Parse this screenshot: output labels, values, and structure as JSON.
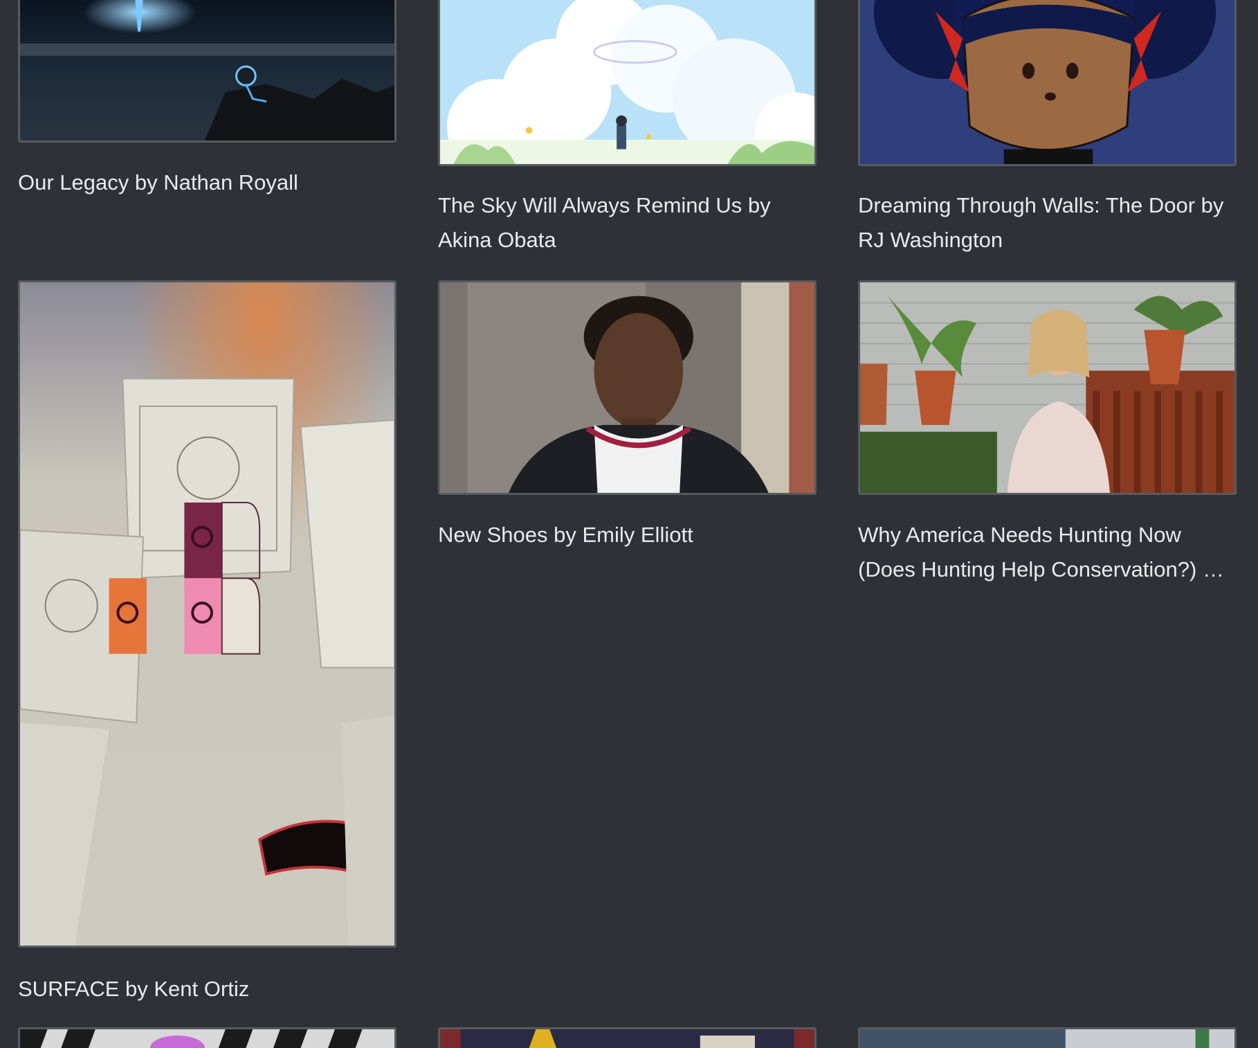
{
  "grid": {
    "items": [
      {
        "id": "our-legacy",
        "title_lines": [
          "Our Legacy by Nathan Royall"
        ]
      },
      {
        "id": "sky-remind",
        "title_lines": [
          "The Sky Will Always Remind Us by",
          "Akina Obata"
        ]
      },
      {
        "id": "dreaming-walls",
        "title_lines": [
          "Dreaming Through Walls: The Door by",
          "RJ Washington"
        ]
      },
      {
        "id": "surface",
        "title_lines": [
          "SURFACE by Kent Ortiz"
        ]
      },
      {
        "id": "new-shoes",
        "title_lines": [
          "New Shoes by Emily Elliott"
        ]
      },
      {
        "id": "hunting",
        "title_lines": [
          "Why America Needs Hunting Now",
          "(Does Hunting Help Conservation?) …"
        ]
      }
    ]
  },
  "colors": {
    "background": "#2e3236",
    "text": "#e9ebec",
    "thumb_border": "#575b5f"
  }
}
